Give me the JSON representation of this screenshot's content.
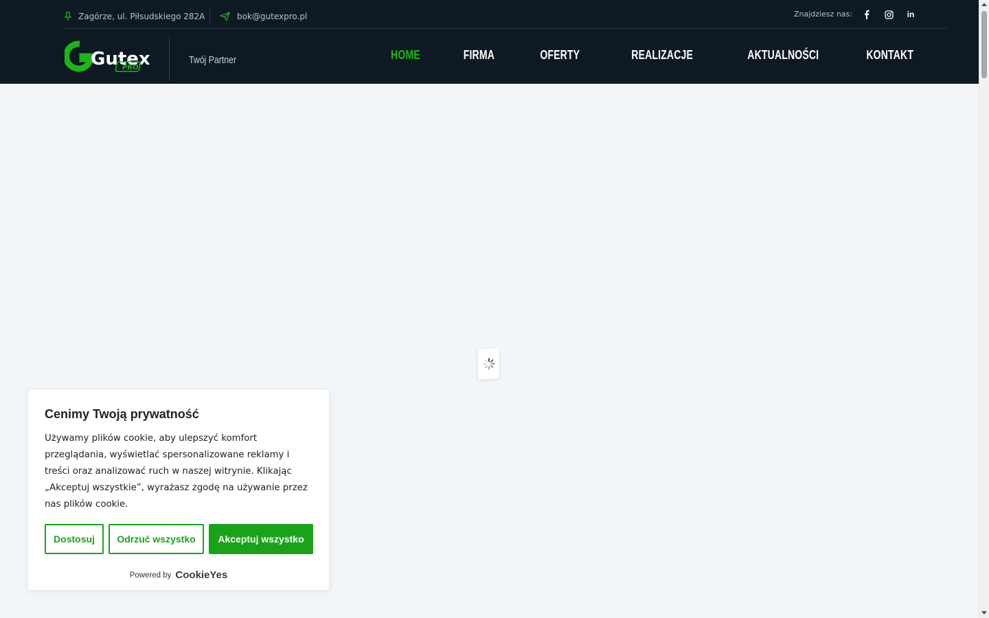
{
  "colors": {
    "accent": "#1fb51a",
    "header_bg": "#0e1a23",
    "button_green": "#1aa31a"
  },
  "topbar": {
    "address": "Zagórze, ul. Piłsudskiego 282A",
    "email": "bok@gutexpro.pl",
    "find_us": "Znajdziesz nas:",
    "social": [
      "facebook-icon",
      "instagram-icon",
      "linkedin-icon"
    ],
    "linkedin_glyph": "in"
  },
  "logo": {
    "main": "Gutex",
    "sub": "PRO"
  },
  "tagline": "Twój Partner",
  "nav": {
    "items": [
      {
        "label": "HOME",
        "active": true
      },
      {
        "label": "FIRMA"
      },
      {
        "label": "OFERTY"
      },
      {
        "label": "REALIZACJE"
      },
      {
        "label": "AKTUALNOŚCI"
      },
      {
        "label": "KONTAKT"
      }
    ]
  },
  "cookie": {
    "title": "Cenimy Twoją prywatność",
    "text": "Używamy plików cookie, aby ulepszyć komfort przeglądania, wyświetlać spersonalizowane reklamy i treści oraz analizować ruch w naszej witrynie. Klikając „Akceptuj wszystkie”, wyrażasz zgodę na używanie przez nas plików cookie.",
    "customize": "Dostosuj",
    "reject": "Odrzuć wszystko",
    "accept": "Akceptuj wszystko",
    "powered_by": "Powered by",
    "brand": "CookieYes"
  }
}
